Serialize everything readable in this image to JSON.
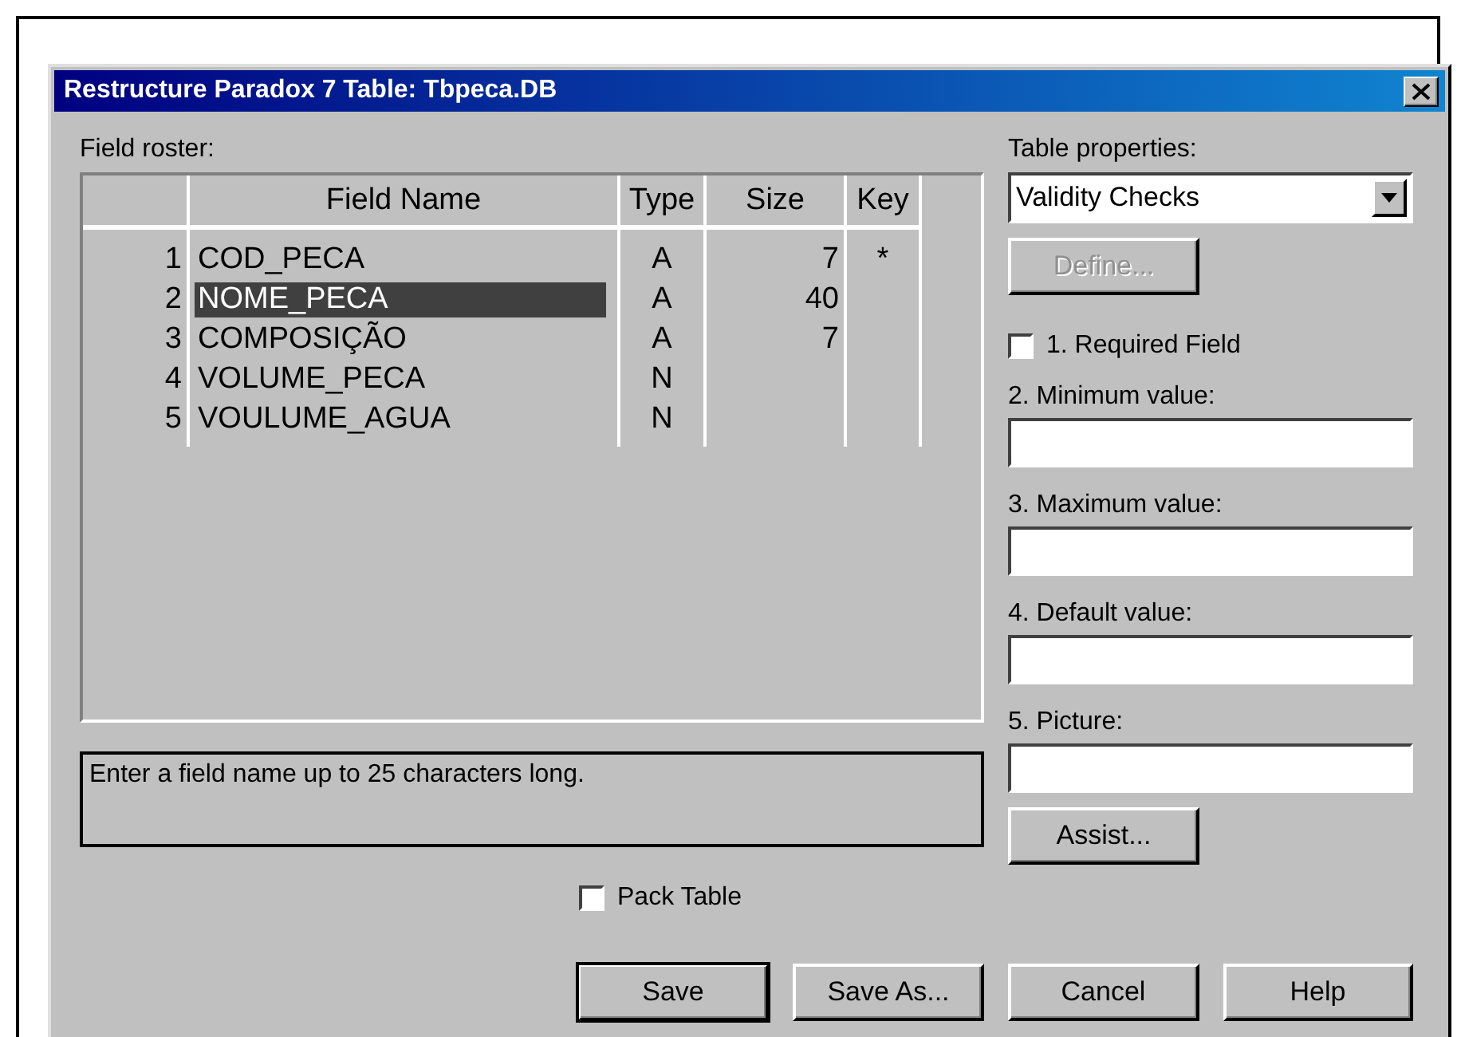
{
  "window": {
    "title": "Restructure Paradox 7 Table: Tbpeca.DB"
  },
  "field_roster": {
    "label": "Field roster:",
    "columns": [
      "Field Name",
      "Type",
      "Size",
      "Key"
    ],
    "rows": [
      {
        "number": "1",
        "name": "COD_PECA",
        "type": "A",
        "size": "7",
        "key": "*",
        "selected": false
      },
      {
        "number": "2",
        "name": "NOME_PECA",
        "type": "A",
        "size": "40",
        "selected": true
      },
      {
        "number": "3",
        "name": "COMPOSIÇÃO",
        "type": "A",
        "size": "7",
        "selected": false
      },
      {
        "number": "4",
        "name": "VOLUME_PECA",
        "type": "N",
        "selected": false
      },
      {
        "number": "5",
        "name": "VOULUME_AGUA",
        "type": "N",
        "selected": false
      }
    ]
  },
  "hint": "Enter a field name up to 25 characters long.",
  "pack_table": {
    "label": "Pack Table",
    "checked": false
  },
  "left_buttons": [
    {
      "label": "Save",
      "default": true
    },
    {
      "label": "Save As...",
      "default": false
    }
  ],
  "table_properties": {
    "label": "Table properties:",
    "value": "Validity Checks"
  },
  "define_button": {
    "label": "Define...",
    "disabled": true
  },
  "required_field": {
    "label": "1. Required Field",
    "checked": false
  },
  "value_fields": [
    {
      "label": "2. Minimum value:"
    },
    {
      "label": "3. Maximum value:"
    },
    {
      "label": "4. Default value:"
    },
    {
      "label": "5. Picture:"
    }
  ],
  "assist_button": {
    "label": "Assist...",
    "disabled": false
  },
  "right_buttons": [
    {
      "label": "Cancel",
      "default": false
    },
    {
      "label": "Help",
      "default": false
    }
  ]
}
